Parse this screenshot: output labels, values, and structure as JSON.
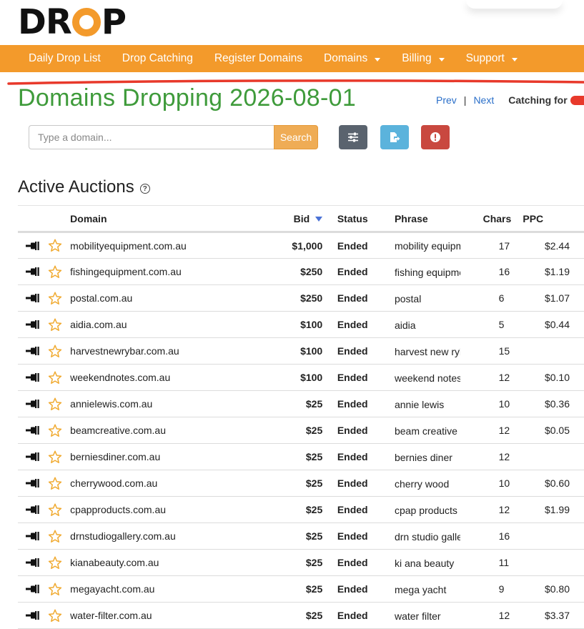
{
  "logo": {
    "text_before": "DR",
    "text_after": "P",
    "accent": "#f39a2b"
  },
  "nav": {
    "items": [
      {
        "label": "Daily Drop List",
        "dropdown": false
      },
      {
        "label": "Drop Catching",
        "dropdown": false
      },
      {
        "label": "Register Domains",
        "dropdown": false
      },
      {
        "label": "Domains",
        "dropdown": true
      },
      {
        "label": "Billing",
        "dropdown": true
      },
      {
        "label": "Support",
        "dropdown": true
      }
    ],
    "color": "#f39a2b"
  },
  "page": {
    "title": "Domains Dropping 2026-08-01",
    "title_color": "#3f9b3b"
  },
  "pager": {
    "prev": "Prev",
    "separator": "|",
    "next": "Next",
    "catching_label": "Catching for"
  },
  "search": {
    "placeholder": "Type a domain...",
    "button": "Search"
  },
  "toolbar": {
    "filter_icon": "sliders-icon",
    "export_icon": "file-export-icon",
    "alert_icon": "exclamation-circle-icon"
  },
  "section": {
    "title": "Active Auctions",
    "help": "?"
  },
  "table": {
    "headers": {
      "domain": "Domain",
      "bid": "Bid",
      "status": "Status",
      "phrase": "Phrase",
      "chars": "Chars",
      "ppc": "PPC"
    },
    "sort_column": "bid",
    "rows": [
      {
        "domain": "mobilityequipment.com.au",
        "bid": "$1,000",
        "status": "Ended",
        "phrase": "mobility equipment",
        "chars": "17",
        "ppc": "$2.44"
      },
      {
        "domain": "fishingequipment.com.au",
        "bid": "$250",
        "status": "Ended",
        "phrase": "fishing equipment",
        "chars": "16",
        "ppc": "$1.19"
      },
      {
        "domain": "postal.com.au",
        "bid": "$250",
        "status": "Ended",
        "phrase": "postal",
        "chars": "6",
        "ppc": "$1.07"
      },
      {
        "domain": "aidia.com.au",
        "bid": "$100",
        "status": "Ended",
        "phrase": "aidia",
        "chars": "5",
        "ppc": "$0.44"
      },
      {
        "domain": "harvestnewrybar.com.au",
        "bid": "$100",
        "status": "Ended",
        "phrase": "harvest new rybar",
        "chars": "15",
        "ppc": ""
      },
      {
        "domain": "weekendnotes.com.au",
        "bid": "$100",
        "status": "Ended",
        "phrase": "weekend notes",
        "chars": "12",
        "ppc": "$0.10"
      },
      {
        "domain": "annielewis.com.au",
        "bid": "$25",
        "status": "Ended",
        "phrase": "annie lewis",
        "chars": "10",
        "ppc": "$0.36"
      },
      {
        "domain": "beamcreative.com.au",
        "bid": "$25",
        "status": "Ended",
        "phrase": "beam creative",
        "chars": "12",
        "ppc": "$0.05"
      },
      {
        "domain": "berniesdiner.com.au",
        "bid": "$25",
        "status": "Ended",
        "phrase": "bernies diner",
        "chars": "12",
        "ppc": ""
      },
      {
        "domain": "cherrywood.com.au",
        "bid": "$25",
        "status": "Ended",
        "phrase": "cherry wood",
        "chars": "10",
        "ppc": "$0.60"
      },
      {
        "domain": "cpapproducts.com.au",
        "bid": "$25",
        "status": "Ended",
        "phrase": "cpap products",
        "chars": "12",
        "ppc": "$1.99"
      },
      {
        "domain": "drnstudiogallery.com.au",
        "bid": "$25",
        "status": "Ended",
        "phrase": "drn studio gallery",
        "chars": "16",
        "ppc": ""
      },
      {
        "domain": "kianabeauty.com.au",
        "bid": "$25",
        "status": "Ended",
        "phrase": "ki ana beauty",
        "chars": "11",
        "ppc": ""
      },
      {
        "domain": "megayacht.com.au",
        "bid": "$25",
        "status": "Ended",
        "phrase": "mega yacht",
        "chars": "9",
        "ppc": "$0.80"
      },
      {
        "domain": "water-filter.com.au",
        "bid": "$25",
        "status": "Ended",
        "phrase": "water filter",
        "chars": "12",
        "ppc": "$3.37"
      }
    ]
  }
}
